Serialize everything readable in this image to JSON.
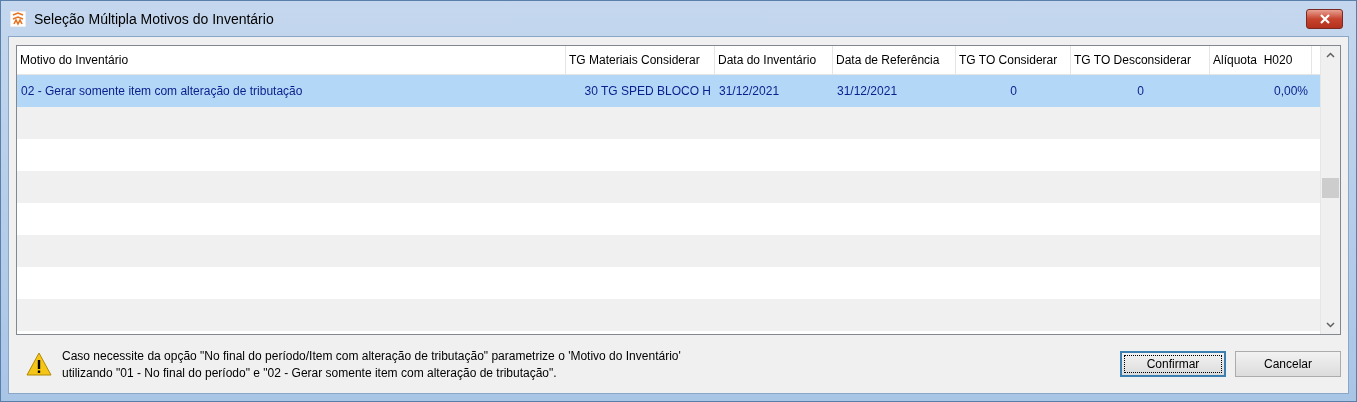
{
  "window": {
    "title": "Seleção Múltipla Motivos do Inventário"
  },
  "table": {
    "columns": [
      "Motivo do Inventário",
      "TG Materiais Considerar",
      "Data do Inventário",
      "Data de Referência",
      "TG TO Considerar",
      "TG TO Desconsiderar",
      "Alíquota  H020"
    ],
    "rows": [
      {
        "selected": true,
        "cells": [
          "02 - Gerar somente item com alteração de tributação",
          "30 TG SPED BLOCO H",
          "31/12/2021",
          "31/12/2021",
          "0",
          "0",
          "0,00%"
        ]
      }
    ]
  },
  "message": {
    "lines": [
      "Caso necessite da opção \"No final do período/Item com alteração de tributação\" parametrize o 'Motivo do Inventário'",
      "utilizando \"01 - No final do período\" e \"02 - Gerar somente item com alteração de tributação\"."
    ]
  },
  "buttons": [
    {
      "label": "Confirmar",
      "default": true
    },
    {
      "label": "Cancelar",
      "default": false
    }
  ]
}
